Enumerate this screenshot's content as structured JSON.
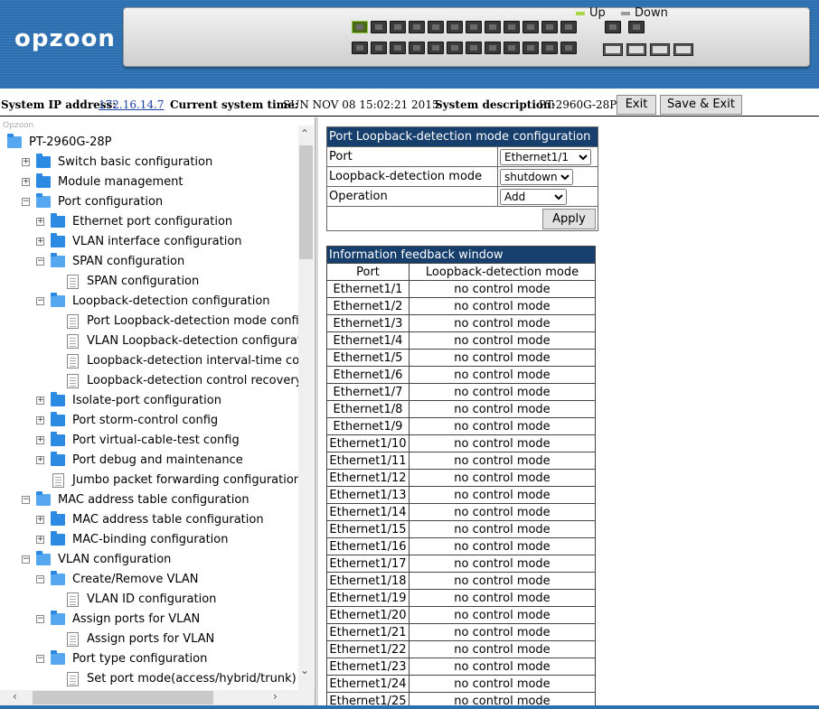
{
  "header": {
    "logo": "opzoon",
    "legend_up": "Up",
    "legend_down": "Down",
    "up_color": "#a6d84a",
    "down_color": "#9a9a9a"
  },
  "infobar": {
    "ip_label": "System IP address:",
    "ip_value": "172.16.14.7",
    "time_label": "Current system time:",
    "time_value": "SUN NOV 08 15:02:21 2015",
    "desc_label": "System description:",
    "desc_value": "PT-2960G-28P",
    "exit": "Exit",
    "save_exit": "Save & Exit"
  },
  "tree": {
    "brand": "Opzoon",
    "nodes": [
      {
        "label": "PT-2960G-28P",
        "icon": "folder-open"
      },
      {
        "label": "Switch basic configuration",
        "icon": "folder"
      },
      {
        "label": "Module management",
        "icon": "folder"
      },
      {
        "label": "Port configuration",
        "icon": "folder-open"
      },
      {
        "label": "Ethernet port configuration",
        "icon": "folder"
      },
      {
        "label": "VLAN interface configuration",
        "icon": "folder"
      },
      {
        "label": "SPAN configuration",
        "icon": "folder-open"
      },
      {
        "label": "SPAN configuration",
        "icon": "page"
      },
      {
        "label": "Loopback-detection configuration",
        "icon": "folder-open"
      },
      {
        "label": "Port Loopback-detection mode config",
        "icon": "page"
      },
      {
        "label": "VLAN Loopback-detection configuratio",
        "icon": "page"
      },
      {
        "label": "Loopback-detection interval-time con",
        "icon": "page"
      },
      {
        "label": "Loopback-detection control recovery",
        "icon": "page"
      },
      {
        "label": "Isolate-port configuration",
        "icon": "folder"
      },
      {
        "label": "Port storm-control config",
        "icon": "folder"
      },
      {
        "label": "Port virtual-cable-test config",
        "icon": "folder"
      },
      {
        "label": "Port debug and maintenance",
        "icon": "folder"
      },
      {
        "label": "Jumbo packet forwarding configuration",
        "icon": "page"
      },
      {
        "label": "MAC address table configuration",
        "icon": "folder-open"
      },
      {
        "label": "MAC address table configuration",
        "icon": "folder"
      },
      {
        "label": "MAC-binding configuration",
        "icon": "folder"
      },
      {
        "label": "VLAN configuration",
        "icon": "folder-open"
      },
      {
        "label": "Create/Remove VLAN",
        "icon": "folder-open"
      },
      {
        "label": "VLAN ID configuration",
        "icon": "page"
      },
      {
        "label": "Assign ports for VLAN",
        "icon": "folder-open"
      },
      {
        "label": "Assign ports for VLAN",
        "icon": "page"
      },
      {
        "label": "Port type configuration",
        "icon": "folder-open"
      },
      {
        "label": "Set port mode(access/hybrid/trunk)",
        "icon": "page"
      }
    ]
  },
  "config": {
    "title": "Port Loopback-detection mode configuration",
    "port_label": "Port",
    "port_value": "Ethernet1/1",
    "mode_label": "Loopback-detection mode",
    "mode_value": "shutdown",
    "op_label": "Operation",
    "op_value": "Add",
    "apply": "Apply"
  },
  "feedback": {
    "title": "Information feedback window",
    "col_port": "Port",
    "col_mode": "Loopback-detection mode",
    "rows": [
      [
        "Ethernet1/1",
        "no control mode"
      ],
      [
        "Ethernet1/2",
        "no control mode"
      ],
      [
        "Ethernet1/3",
        "no control mode"
      ],
      [
        "Ethernet1/4",
        "no control mode"
      ],
      [
        "Ethernet1/5",
        "no control mode"
      ],
      [
        "Ethernet1/6",
        "no control mode"
      ],
      [
        "Ethernet1/7",
        "no control mode"
      ],
      [
        "Ethernet1/8",
        "no control mode"
      ],
      [
        "Ethernet1/9",
        "no control mode"
      ],
      [
        "Ethernet1/10",
        "no control mode"
      ],
      [
        "Ethernet1/11",
        "no control mode"
      ],
      [
        "Ethernet1/12",
        "no control mode"
      ],
      [
        "Ethernet1/13",
        "no control mode"
      ],
      [
        "Ethernet1/14",
        "no control mode"
      ],
      [
        "Ethernet1/15",
        "no control mode"
      ],
      [
        "Ethernet1/16",
        "no control mode"
      ],
      [
        "Ethernet1/17",
        "no control mode"
      ],
      [
        "Ethernet1/18",
        "no control mode"
      ],
      [
        "Ethernet1/19",
        "no control mode"
      ],
      [
        "Ethernet1/20",
        "no control mode"
      ],
      [
        "Ethernet1/21",
        "no control mode"
      ],
      [
        "Ethernet1/22",
        "no control mode"
      ],
      [
        "Ethernet1/23",
        "no control mode"
      ],
      [
        "Ethernet1/24",
        "no control mode"
      ],
      [
        "Ethernet1/25",
        "no control mode"
      ]
    ]
  }
}
